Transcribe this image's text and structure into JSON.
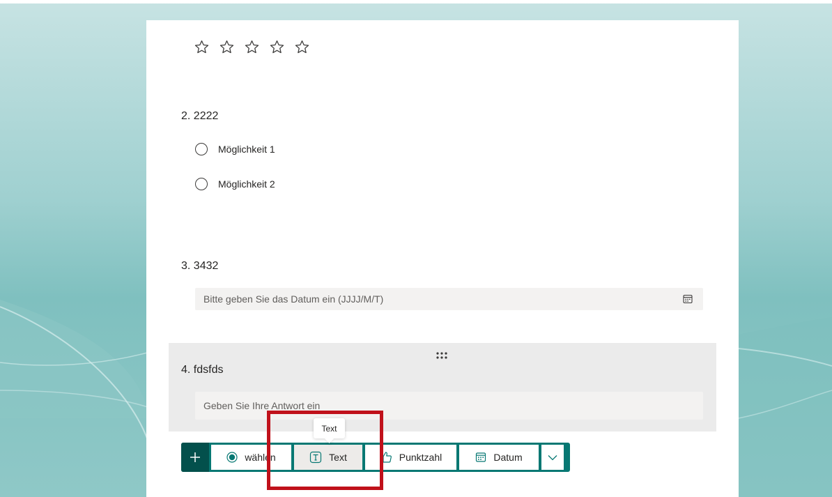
{
  "colors": {
    "accent": "#077873",
    "accent_dark": "#03504c",
    "highlight": "#c0111b",
    "card_bg": "#ffffff",
    "selected_bg": "#ebebeb"
  },
  "rating": {
    "icon": "star-outline-icon",
    "count": 5
  },
  "questions": [
    {
      "title": "2. 2222",
      "options": [
        {
          "label": "Möglichkeit 1"
        },
        {
          "label": "Möglichkeit 2"
        }
      ]
    },
    {
      "title": "3. 3432",
      "input_placeholder": "Bitte geben Sie das Datum ein (JJJJ/M/T)",
      "icon": "calendar-icon"
    },
    {
      "title": "4. fdsfds",
      "input_placeholder": "Geben Sie Ihre Antwort ein",
      "icon": "drag-handle-icon"
    }
  ],
  "toolbar": {
    "add_icon": "plus-icon",
    "choice_label": "wählen",
    "text_label": "Text",
    "rating_label": "Punktzahl",
    "date_label": "Datum",
    "more_icon": "chevron-down-icon"
  },
  "tooltip": {
    "text": "Text"
  }
}
